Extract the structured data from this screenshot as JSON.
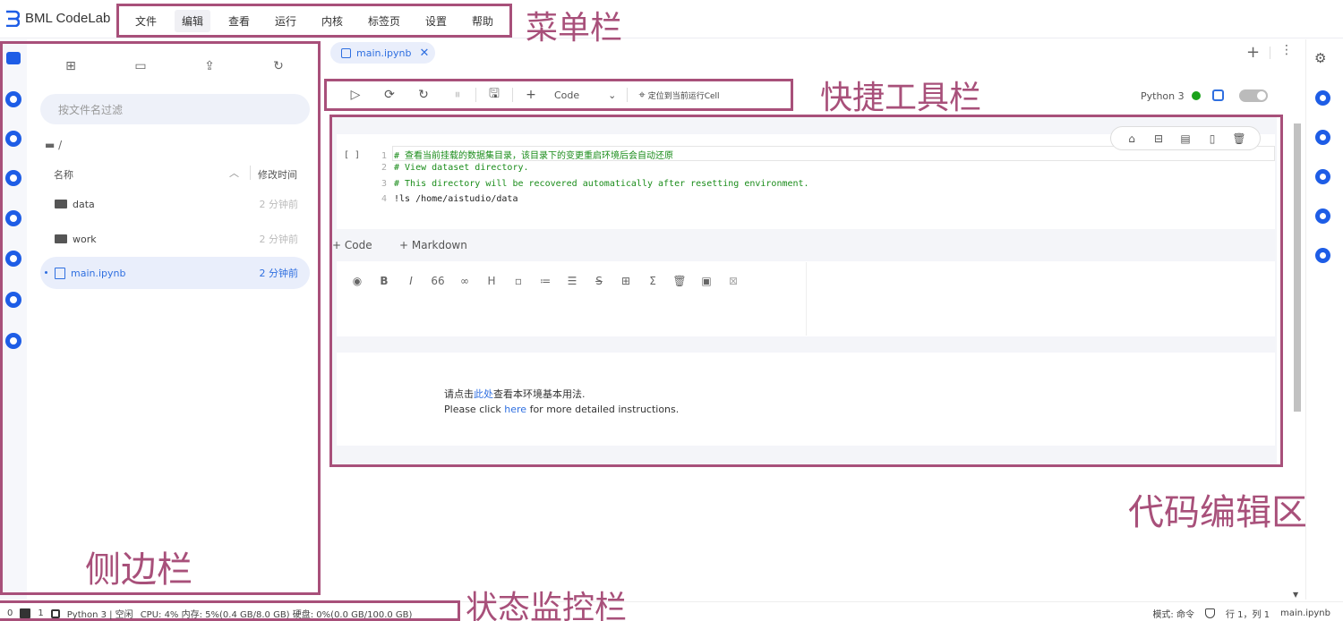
{
  "app": {
    "name": "BML CodeLab"
  },
  "menu": {
    "items": [
      "文件",
      "编辑",
      "查看",
      "运行",
      "内核",
      "标签页",
      "设置",
      "帮助"
    ],
    "active_index": 1
  },
  "annotations": {
    "menubar": "菜单栏",
    "toolbar": "快捷工具栏",
    "editor": "代码编辑区",
    "sidebar": "侧边栏",
    "statusbar": "状态监控栏"
  },
  "sidebar": {
    "filter_placeholder": "按文件名过滤",
    "breadcrumb": "/",
    "header": {
      "name": "名称",
      "modified": "修改时间"
    },
    "files": [
      {
        "name": "data",
        "time": "2 分钟前",
        "type": "folder",
        "selected": false
      },
      {
        "name": "work",
        "time": "2 分钟前",
        "type": "folder",
        "selected": false
      },
      {
        "name": "main.ipynb",
        "time": "2 分钟前",
        "type": "notebook",
        "selected": true
      }
    ]
  },
  "tabs": [
    {
      "label": "main.ipynb",
      "active": true
    }
  ],
  "toolbar": {
    "cell_type": "Code",
    "locate_label": "定位到当前运行Cell",
    "kernel": "Python 3",
    "kernel_status_color": "#1aa21a"
  },
  "notebook": {
    "code_cell": {
      "prompt": "[ ]",
      "lines": [
        {
          "n": "1",
          "text": "# 查看当前挂载的数据集目录，该目录下的变更重启环境后会自动还原",
          "kind": "comment"
        },
        {
          "n": "2",
          "text": "# View dataset directory.",
          "kind": "comment"
        },
        {
          "n": "3",
          "text": "# This directory will be recovered automatically after resetting environment.",
          "kind": "comment"
        },
        {
          "n": "4",
          "text": "!ls /home/aistudio/data",
          "kind": "code"
        }
      ]
    },
    "add_code_label": "Code",
    "add_markdown_label": "Markdown",
    "markdown_tools": [
      "preview-icon",
      "bold-icon",
      "italic-icon",
      "quote-icon",
      "link-icon",
      "heading-icon",
      "file-icon",
      "ordered-list-icon",
      "unordered-list-icon",
      "strikethrough-icon",
      "table-icon",
      "formula-icon",
      "delete-icon",
      "image-icon",
      "unlink-icon"
    ],
    "output": {
      "line1_prefix": "请点击",
      "line1_link": "此处",
      "line1_suffix": "查看本环境基本用法.",
      "line2_prefix": "Please click ",
      "line2_link": "here",
      "line2_suffix": " for more detailed instructions."
    }
  },
  "status": {
    "left_num1": "0",
    "left_num2": "1",
    "kernel_state": "Python 3 | 空闲",
    "resources": "CPU:  4% 内存:  5%(0.4 GB/8.0 GB) 硬盘:  0%(0.0 GB/100.0 GB)",
    "mode": "模式: 命令",
    "position": "行 1，列 1",
    "file": "main.ipynb"
  },
  "colors": {
    "accent": "#2f6fe0",
    "annotation": "#a8507a",
    "brand": "#1e5de6"
  }
}
